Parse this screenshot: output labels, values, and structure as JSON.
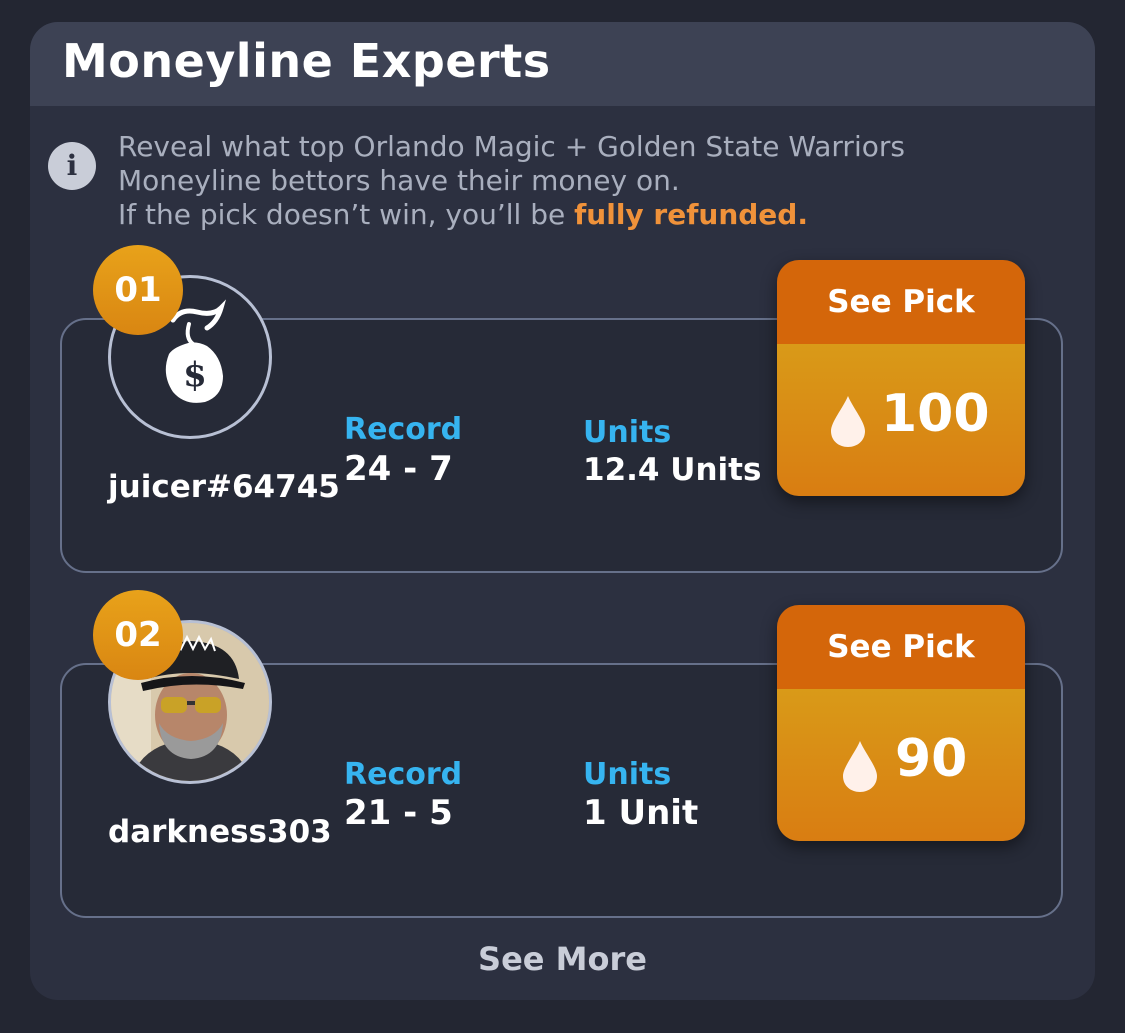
{
  "header": {
    "title": "Moneyline Experts"
  },
  "info": {
    "icon": "info-icon",
    "line1": "Reveal what top Orlando Magic + Golden State Warriors",
    "line2": "Moneyline bettors have their money on.",
    "line3_prefix": "If the pick doesn’t win, you’ll be ",
    "line3_highlight": "fully refunded."
  },
  "experts": [
    {
      "rank": "01",
      "username": "juicer#64745",
      "avatar_icon": "money-bag-icon",
      "record_label": "Record",
      "record_value": "24 - 7",
      "units_label": "Units",
      "units_value": "12.4 Units",
      "pick_label": "See Pick",
      "pick_cost_icon": "drop-icon",
      "pick_cost": "100"
    },
    {
      "rank": "02",
      "username": "darkness303",
      "avatar_icon": "user-photo",
      "record_label": "Record",
      "record_value": "21 - 5",
      "units_label": "Units",
      "units_value": "1 Unit",
      "pick_label": "See Pick",
      "pick_cost_icon": "drop-icon",
      "pick_cost": "90"
    }
  ],
  "footer": {
    "see_more": "See More"
  },
  "colors": {
    "background": "#232632",
    "card": "#2c3040",
    "header": "#3d4254",
    "accent_orange": "#d4660a",
    "accent_gold": "#e8a21a",
    "stat_label_blue": "#36b4f0",
    "refund_orange": "#f0923a"
  }
}
